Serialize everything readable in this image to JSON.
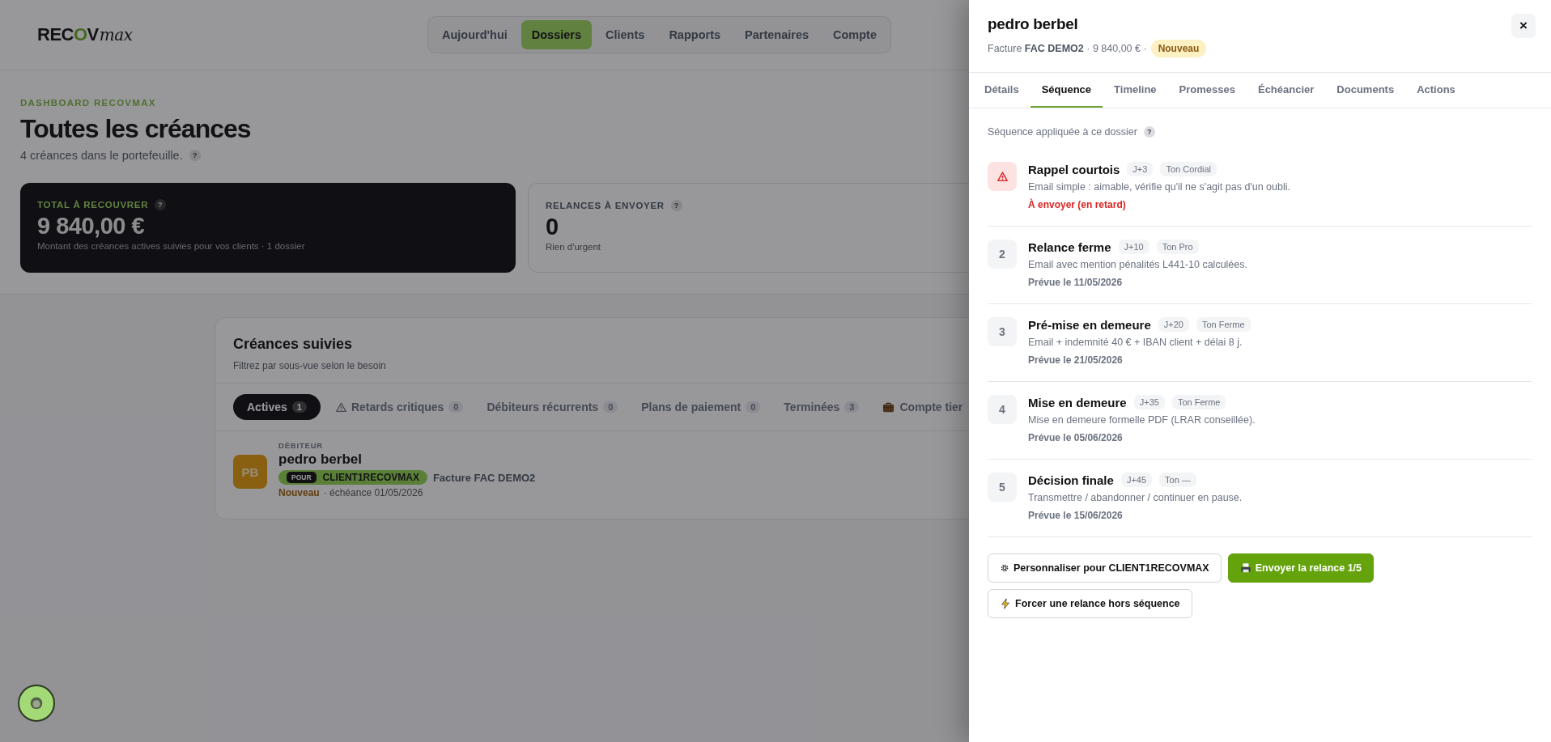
{
  "logo": {
    "parts": [
      {
        "text": "REC",
        "kind": "plain"
      },
      {
        "text": "O",
        "kind": "ring"
      },
      {
        "text": "V",
        "kind": "plain"
      },
      {
        "text": "max",
        "kind": "script"
      }
    ]
  },
  "nav": [
    {
      "label": "Aujourd'hui",
      "selected": false
    },
    {
      "label": "Dossiers",
      "selected": true
    },
    {
      "label": "Clients",
      "selected": false
    },
    {
      "label": "Rapports",
      "selected": false
    },
    {
      "label": "Partenaires",
      "selected": false
    },
    {
      "label": "Compte",
      "selected": false
    }
  ],
  "dashboard": {
    "eyebrow": "DASHBOARD RECOVMAX",
    "title": "Toutes les créances",
    "subtitle": "4 créances dans le portefeuille.",
    "help": "?"
  },
  "stats": [
    {
      "kind": "dark",
      "label": "TOTAL À RECOUVRER",
      "help": "?",
      "value": "9 840,00 €",
      "caption": "Montant des créances actives suivies pour vos clients · 1 dossier"
    },
    {
      "kind": "light",
      "label": "RELANCES À ENVOYER",
      "help": "?",
      "value": "0",
      "caption": "Rien d'urgent"
    }
  ],
  "tracked": {
    "title": "Créances suivies",
    "subtitle": "Filtrez par sous-vue selon le besoin",
    "filters": [
      {
        "kind": "plain",
        "label": "Actives",
        "count": "1",
        "selected": true
      },
      {
        "kind": "alert",
        "label": "Retards critiques",
        "count": "0",
        "selected": false
      },
      {
        "kind": "plain",
        "label": "Débiteurs récurrents",
        "count": "0",
        "selected": false
      },
      {
        "kind": "plain",
        "label": "Plans de paiement",
        "count": "0",
        "selected": false
      },
      {
        "kind": "plain",
        "label": "Terminées",
        "count": "3",
        "selected": false
      },
      {
        "kind": "account",
        "label": "Compte tier",
        "selected": false
      }
    ],
    "rows": [
      {
        "initials": "PB",
        "eyebrow": "DÉBITEUR",
        "name": "pedro berbel",
        "for_label": "POUR",
        "client": "CLIENT1RECOVMAX",
        "invoice": "Facture FAC DEMO2",
        "status": "Nouveau",
        "due": "· échéance 01/05/2026"
      }
    ]
  },
  "drawer": {
    "title": "pedro berbel",
    "subtitle": "Facture **FAC DEMO2** · 9 840,00 € ·",
    "badge": "Nouveau",
    "close": "×",
    "tabs": [
      {
        "label": "Détails",
        "selected": false
      },
      {
        "label": "Séquence",
        "selected": true
      },
      {
        "label": "Timeline",
        "selected": false
      },
      {
        "label": "Promesses",
        "selected": false
      },
      {
        "label": "Échéancier",
        "selected": false
      },
      {
        "label": "Documents",
        "selected": false
      },
      {
        "label": "Actions",
        "selected": false
      }
    ],
    "intro": "Séquence appliquée à ce dossier",
    "help": "?",
    "steps": [
      {
        "kind": "overdue",
        "title": "Rappel courtois",
        "delay": "J+3",
        "tone": "Ton Cordial",
        "description": "Email simple : aimable, vérifie qu'il ne s'agit pas d'un oubli.",
        "status": "À envoyer (en retard)"
      },
      {
        "kind": "planned",
        "number": "2",
        "title": "Relance ferme",
        "delay": "J+10",
        "tone": "Ton Pro",
        "description": "Email avec mention pénalités L441-10 calculées.",
        "status": "Prévue le 11/05/2026"
      },
      {
        "kind": "planned",
        "number": "3",
        "title": "Pré-mise en demeure",
        "delay": "J+20",
        "tone": "Ton Ferme",
        "description": "Email + indemnité 40 € + IBAN client + délai 8 j.",
        "status": "Prévue le 21/05/2026"
      },
      {
        "kind": "planned",
        "number": "4",
        "title": "Mise en demeure",
        "delay": "J+35",
        "tone": "Ton Ferme",
        "description": "Mise en demeure formelle PDF (LRAR conseillée).",
        "status": "Prévue le 05/06/2026"
      },
      {
        "kind": "planned",
        "number": "5",
        "title": "Décision finale",
        "delay": "J+45",
        "tone": "Ton —",
        "description": "Transmettre / abandonner / continuer en pause.",
        "status": "Prévue le 15/06/2026"
      }
    ],
    "button_rows": [
      {
        "buttons": [
          {
            "label": "Personnaliser pour CLIENT1RECOVMAX",
            "kind": "customize"
          },
          {
            "label": "Envoyer la relance 1/5",
            "kind": "send"
          }
        ]
      },
      {
        "buttons": [
          {
            "label": "Forcer une relance hors séquence",
            "kind": "force"
          }
        ]
      }
    ]
  }
}
